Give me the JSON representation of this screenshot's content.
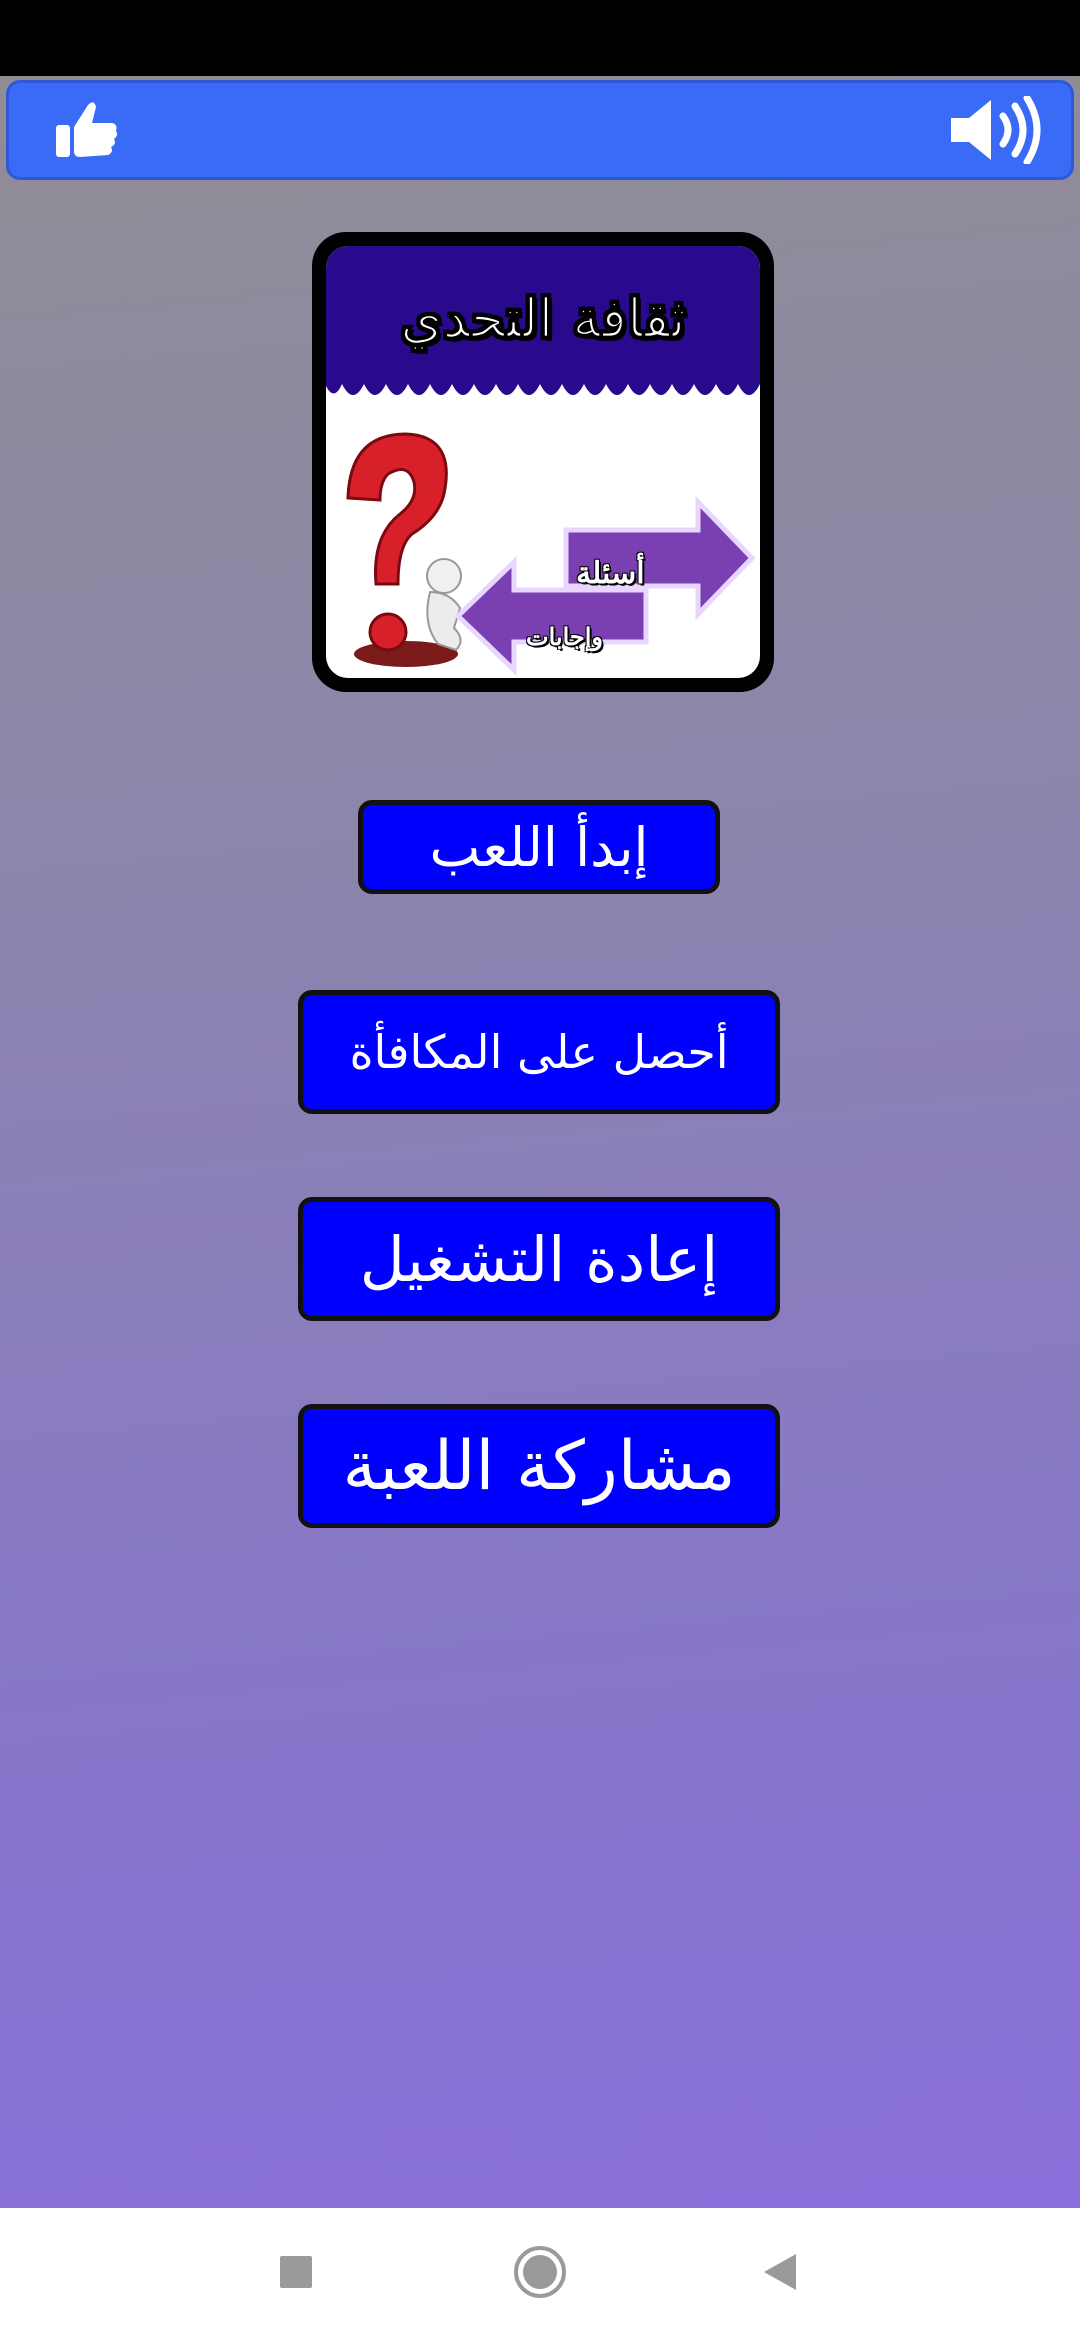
{
  "app": {
    "logo_title": "ثقافة التحدي",
    "logo_arrow_questions": "أسئلة",
    "logo_arrow_answers": "وإجابات"
  },
  "top_bar": {
    "like_icon": "thumbs-up-icon",
    "sound_icon": "speaker-volume-icon",
    "color": "#3a6bf7"
  },
  "menu": {
    "play_label": "إبدأ اللعب",
    "reward_label": "أحصل على المكافأة",
    "restart_label": "إعادة التشغيل",
    "share_label": "مشاركة اللعبة",
    "button_color": "#0000ff"
  },
  "navigation": {
    "recents_icon": "square-recents-icon",
    "home_icon": "circle-home-icon",
    "back_icon": "triangle-back-icon"
  }
}
